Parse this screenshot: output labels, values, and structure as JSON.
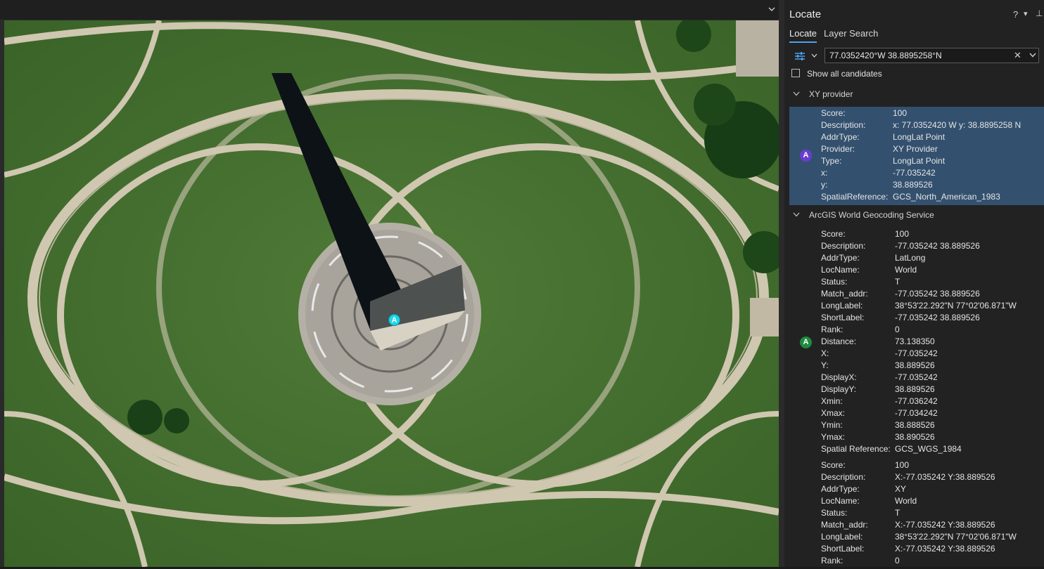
{
  "panel": {
    "title": "Locate",
    "help": "?",
    "options": "▾",
    "pin": "⊥"
  },
  "tabs": [
    {
      "label": "Locate",
      "active": true
    },
    {
      "label": "Layer Search",
      "active": false
    }
  ],
  "search": {
    "value": "77.0352420°W 38.8895258°N",
    "clear_icon": "✕"
  },
  "show_all_candidates": {
    "label": "Show all candidates",
    "checked": false
  },
  "map": {
    "marker_label": "A"
  },
  "colors": {
    "selected_row": "#33516f",
    "accent": "#4ba3f0",
    "xy_badge": "#6a3ccf",
    "world_badge": "#1f8a3e",
    "map_marker": "#1dd6e8"
  },
  "groups": [
    {
      "name": "XY provider",
      "candidates": [
        {
          "badge": "A",
          "selected": true,
          "fields": [
            {
              "k": "Score:",
              "v": "100"
            },
            {
              "k": "Description:",
              "v": "x: 77.0352420 W y: 38.8895258 N"
            },
            {
              "k": "AddrType:",
              "v": "LongLat Point"
            },
            {
              "k": "Provider:",
              "v": "XY Provider"
            },
            {
              "k": "Type:",
              "v": "LongLat Point"
            },
            {
              "k": "x:",
              "v": "-77.035242"
            },
            {
              "k": "y:",
              "v": "38.889526"
            },
            {
              "k": "SpatialReference:",
              "v": "GCS_North_American_1983"
            }
          ]
        }
      ]
    },
    {
      "name": "ArcGIS World Geocoding Service",
      "candidates": [
        {
          "badge": "A",
          "selected": false,
          "fields": [
            {
              "k": "Score:",
              "v": "100"
            },
            {
              "k": "Description:",
              "v": "-77.035242 38.889526"
            },
            {
              "k": "AddrType:",
              "v": "LatLong"
            },
            {
              "k": "LocName:",
              "v": "World"
            },
            {
              "k": "Status:",
              "v": "T"
            },
            {
              "k": "Match_addr:",
              "v": "-77.035242 38.889526"
            },
            {
              "k": "LongLabel:",
              "v": "38°53'22.292\"N 77°02'06.871\"W"
            },
            {
              "k": "ShortLabel:",
              "v": "-77.035242 38.889526"
            },
            {
              "k": "Rank:",
              "v": "0"
            },
            {
              "k": "Distance:",
              "v": "73.138350"
            },
            {
              "k": "X:",
              "v": "-77.035242"
            },
            {
              "k": "Y:",
              "v": "38.889526"
            },
            {
              "k": "DisplayX:",
              "v": "-77.035242"
            },
            {
              "k": "DisplayY:",
              "v": "38.889526"
            },
            {
              "k": "Xmin:",
              "v": "-77.036242"
            },
            {
              "k": "Xmax:",
              "v": "-77.034242"
            },
            {
              "k": "Ymin:",
              "v": "38.888526"
            },
            {
              "k": "Ymax:",
              "v": "38.890526"
            },
            {
              "k": "Spatial Reference:",
              "v": "GCS_WGS_1984"
            }
          ]
        },
        {
          "badge": "",
          "selected": false,
          "fields": [
            {
              "k": "Score:",
              "v": "100"
            },
            {
              "k": "Description:",
              "v": "X:-77.035242 Y:38.889526"
            },
            {
              "k": "AddrType:",
              "v": "XY"
            },
            {
              "k": "LocName:",
              "v": "World"
            },
            {
              "k": "Status:",
              "v": "T"
            },
            {
              "k": "Match_addr:",
              "v": "X:-77.035242 Y:38.889526"
            },
            {
              "k": "LongLabel:",
              "v": "38°53'22.292\"N 77°02'06.871\"W"
            },
            {
              "k": "ShortLabel:",
              "v": "X:-77.035242 Y:38.889526"
            },
            {
              "k": "Rank:",
              "v": "0"
            }
          ]
        }
      ]
    }
  ]
}
